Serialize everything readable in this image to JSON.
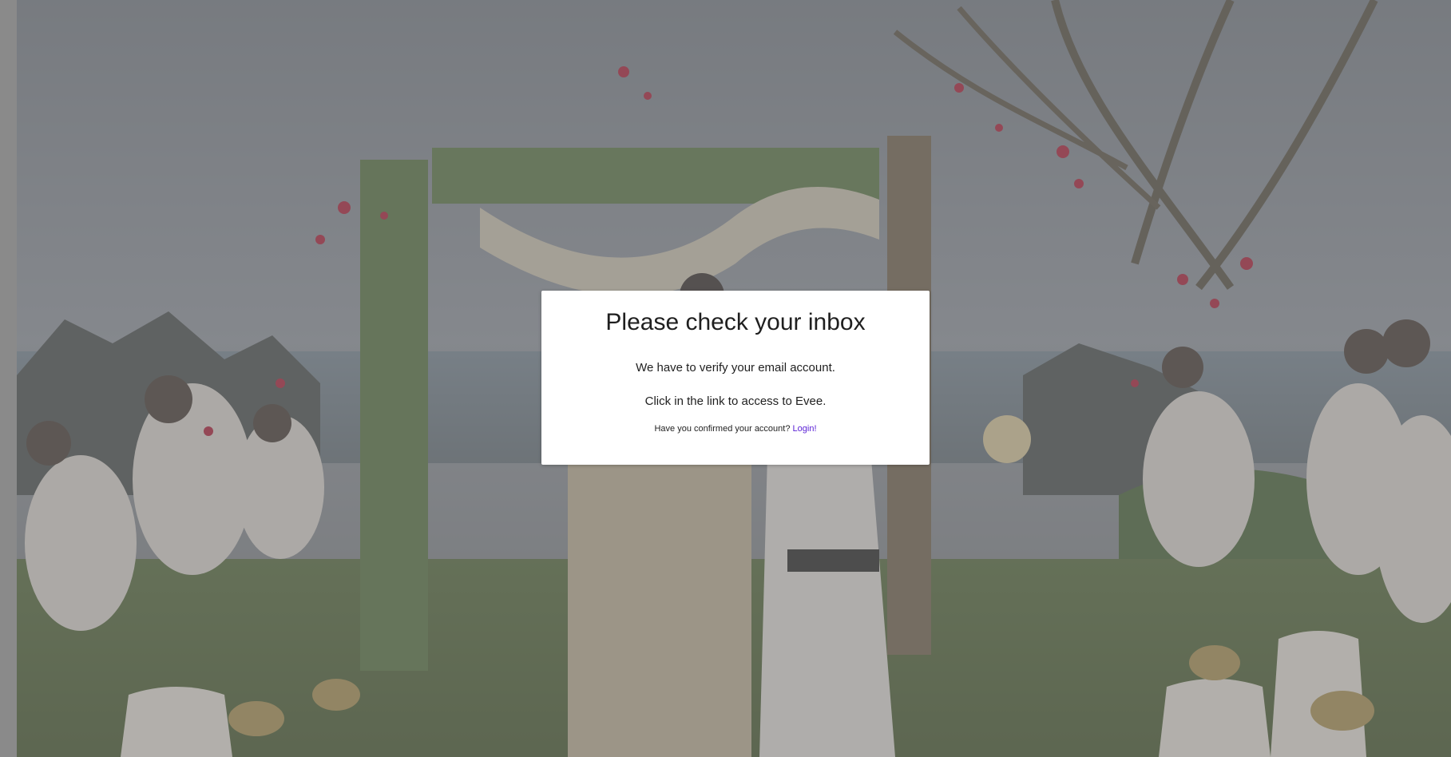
{
  "modal": {
    "title": "Please check your inbox",
    "line1": "We have to verify your email account.",
    "line2": "Click in the link to access to Evee.",
    "confirm_prompt": "Have you confirmed your account?",
    "login_link": "Login!"
  },
  "colors": {
    "overlay": "#7f7f7f",
    "modal_bg": "#ffffff",
    "link": "#5b21d6",
    "text": "#1f1f1f"
  }
}
